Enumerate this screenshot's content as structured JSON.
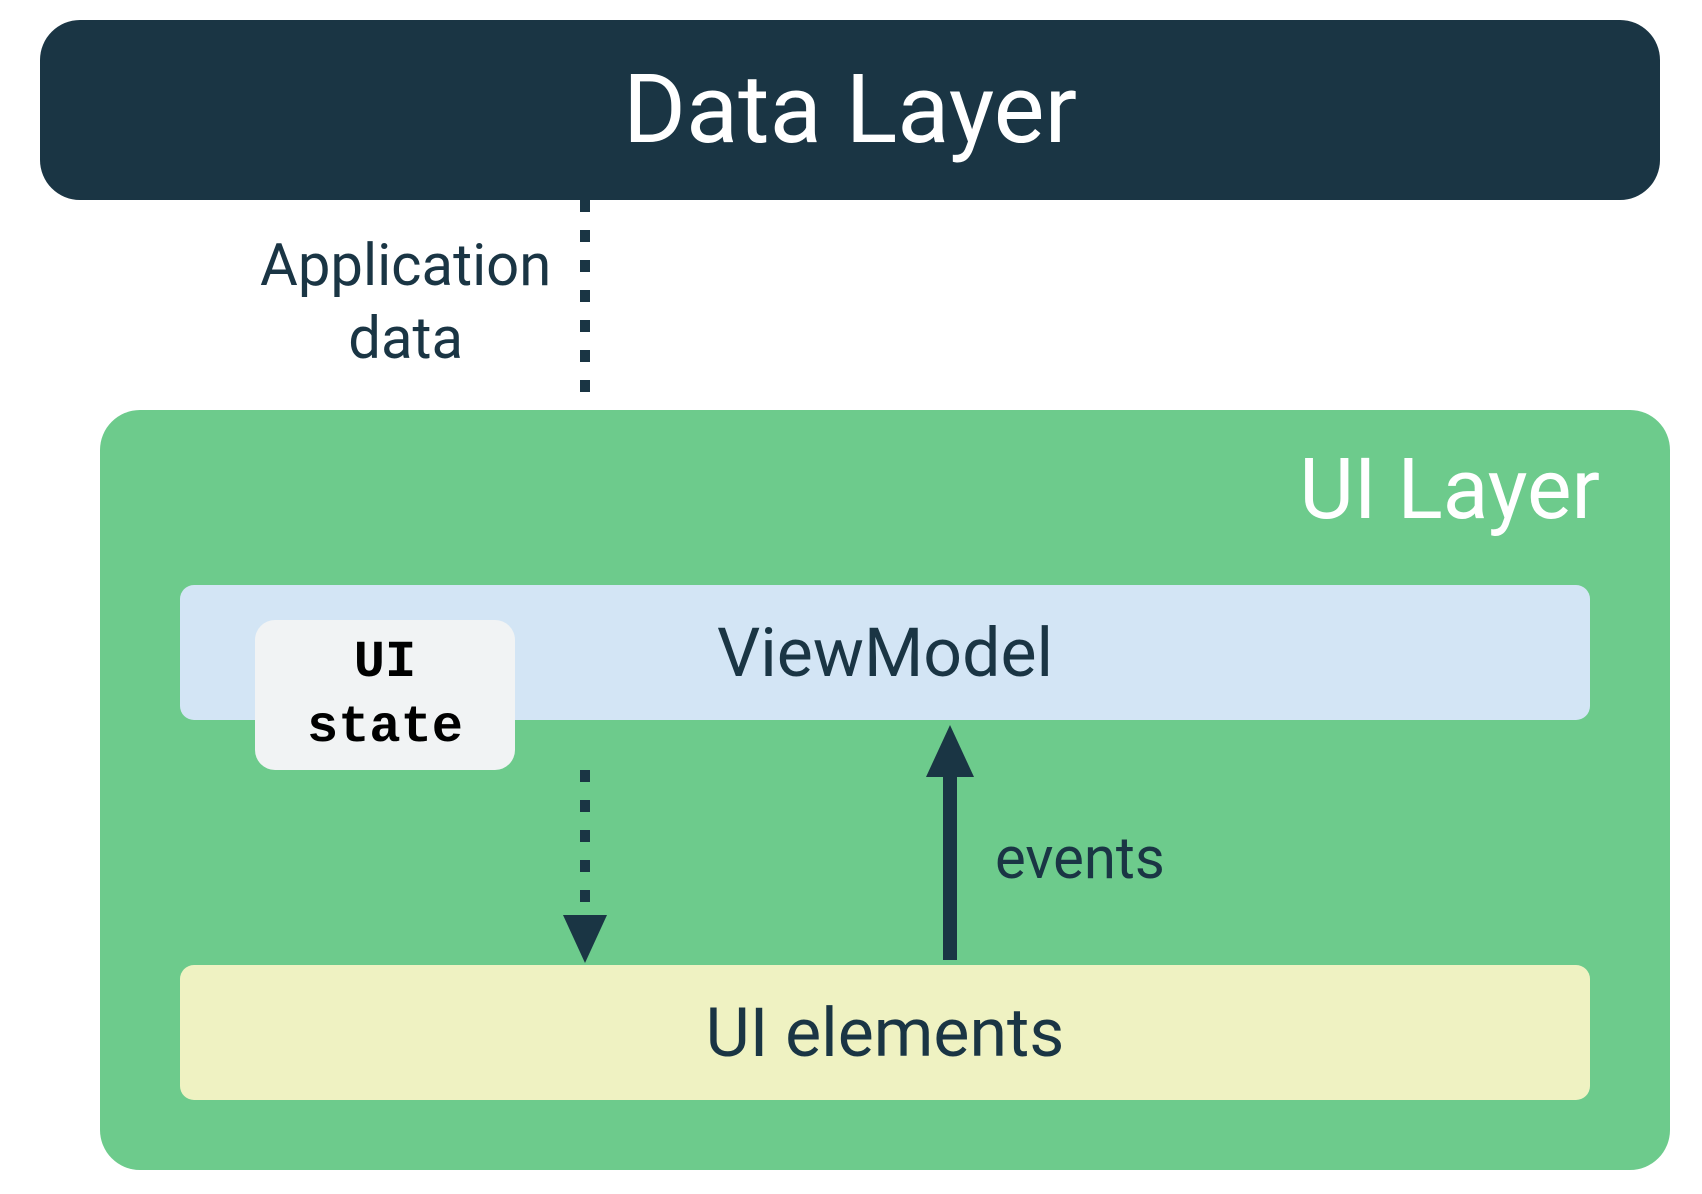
{
  "layers": {
    "data_layer": "Data Layer",
    "ui_layer": "UI Layer"
  },
  "boxes": {
    "viewmodel": "ViewModel",
    "ui_elements": "UI elements",
    "ui_state": "UI\nstate"
  },
  "arrows": {
    "app_data_label": "Application\ndata",
    "events_label": "events"
  },
  "colors": {
    "dark_navy": "#1a3544",
    "green": "#6dcb8c",
    "light_blue": "#d3e5f5",
    "light_yellow": "#eff2c2",
    "light_gray": "#f1f3f4"
  },
  "diagram_structure": {
    "description": "Architecture diagram showing data flow between Data Layer and UI Layer",
    "flow": [
      {
        "from": "Data Layer",
        "to": "ViewModel",
        "label": "Application data",
        "style": "dotted"
      },
      {
        "from": "ViewModel",
        "via": "UI state",
        "to": "UI elements",
        "style": "dotted"
      },
      {
        "from": "UI elements",
        "to": "ViewModel",
        "label": "events",
        "style": "solid"
      }
    ]
  }
}
